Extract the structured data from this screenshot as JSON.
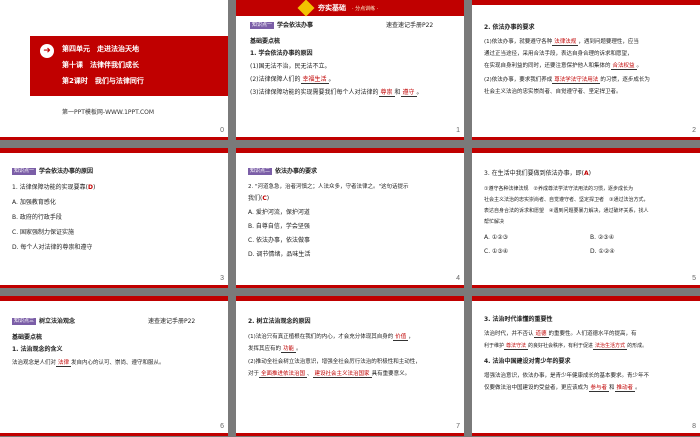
{
  "s0": {
    "num": "0",
    "unit": "第四单元　走进法治天地",
    "lesson": "第十课　法律伴我们成长",
    "period": "第2课时　我们与法律同行",
    "footer": "第一PPT模板网-WWW.1PPT.COM"
  },
  "s1": {
    "num": "1",
    "banner": "夯实基础",
    "banner_sub": "· 分点训练 ·",
    "tag": "知识点一",
    "head": "学会依法办事",
    "manual": "速查速记手册P22",
    "title": "基础要点梳",
    "l1": "1. 学会依法办事的原因",
    "l2a": "(1)国无法不治，民无法不立。",
    "l3a": "(2)法律保障人们的",
    "l3b": "幸福生活",
    "l3c": "。",
    "l4a": "(3)法律保障功能的实现需要我们每个人对法律的",
    "l4b": "尊崇",
    "l4c": "和",
    "l4d": "遵守",
    "l4e": "。"
  },
  "s2": {
    "num": "2",
    "l1": "2. 依法办事的要求",
    "l2a": "(1)依法办事，就要遵守各种",
    "l2b": "法律法规",
    "l2c": "，遇到问题要理性，应当",
    "l3": "通过正当途径，采用合法手段，表达自身合理的诉求和愿望，",
    "l4a": "在实现自身利益的同时，还要注意保护他人和集体的",
    "l4b": "合法权益",
    "l4c": "。",
    "l5a": "(2)依法办事，要求我们养成",
    "l5b": "尊法学法守法用法",
    "l5c": "的习惯，逐步成长为",
    "l6": "社会主义法治的忠实崇尚者、自觉遵守者、坚定捍卫者。"
  },
  "s3": {
    "num": "3",
    "tag": "知识点一",
    "head": "学会依法办事的原因",
    "q_a": "1. 法律保障功能的实现要靠(",
    "q_ans": "D",
    "q_b": ")",
    "a": "A. 加强教育感化",
    "b": "B. 政府的行政手段",
    "c": "C. 国家强制力保证实施",
    "d": "D. 每个人对法律的尊崇和遵守"
  },
  "s4": {
    "num": "4",
    "tag": "知识点二",
    "head": "依法办事的要求",
    "q1": "2. \"河道急急，治者河慎之；人法众多，守者法律之。\"这句话提示",
    "q2a": "我们(",
    "q2b": "C",
    "q2c": ")",
    "a": "A. 爱护河流，保护河道",
    "b": "B. 自尊自信，学会坚强",
    "c": "C. 依法办事，依法做事",
    "d": "D. 调节情绪，品味生活"
  },
  "s5": {
    "num": "5",
    "q1a": "3. 在生活中我们要做到依法办事，即(",
    "q1b": "A",
    "q1c": ")",
    "l1": "①遵守各种法律法规　②养成尊法学法守法用法的习惯，逐步成长为",
    "l2": "社会主义法治的忠实崇尚者、自觉遵守者、坚定捍卫者　③通过法治方式，",
    "l3": "表达自身合法的诉求和愿望　④遇到问题要暴力解决，通过破坏关系，找人",
    "l4": "帮忙解决",
    "a": "A. ①②③",
    "b": "B. ②③④",
    "c": "C. ①③④",
    "d": "D. ①②④"
  },
  "s6": {
    "num": "6",
    "tag": "知识点三",
    "head": "树立法治观念",
    "manual": "速查速记手册P22",
    "title": "基础要点梳",
    "l1": "1. 法治观念的含义",
    "l2a": "法治观念是人们对",
    "l2b": "法律",
    "l2c": "发自内心的认可、崇尚、遵守和服从。"
  },
  "s7": {
    "num": "7",
    "l1": "2. 树立法治观念的原因",
    "l2a": "(1)法治只有真正植根在我们的内心，才会充分体现其自身的",
    "l2b": "价值",
    "l2c": "，",
    "l3a": "发挥其应有的",
    "l3b": "功能",
    "l3c": "。",
    "l4": "(2)推动全社会树立法治意识，增强全社会厉行法治的积极性和主动性，",
    "l5a": "对于",
    "l5b": "全面推进依法治国",
    "l5c": "、",
    "l5d": "建设社会主义法治国家",
    "l5e": "具有重要意义。"
  },
  "s8": {
    "num": "8",
    "l1": "3. 法治时代谁懂的重要性",
    "l2a": "法治时代，并不否认",
    "l2b": "道德",
    "l2c": "的重要性。人们道德水平的提高，有",
    "l3a": "利于维护",
    "l3b": "尊法守法",
    "l3c": "的良好社会秩序，有利于促进",
    "l3d": "法治生活方式",
    "l3e": "的形成。",
    "l4": "4. 法治中国建设对青少年的要求",
    "l5": "增强法治意识，依法办事，是青少年健康成长的基本要求。青少年不",
    "l6a": "仅要做法治中国建设的受益者，更应该成为",
    "l6b": "参与者",
    "l6c": "和",
    "l6d": "推动者",
    "l6e": "。"
  }
}
